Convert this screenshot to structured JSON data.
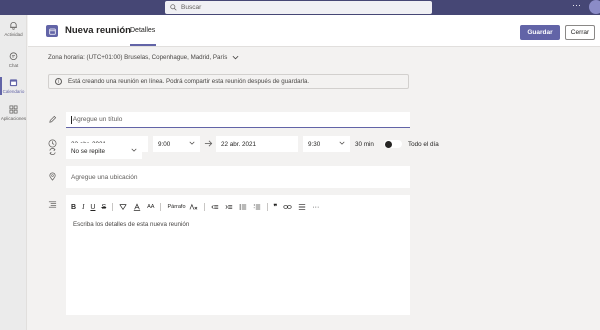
{
  "top_bar": {
    "search_placeholder": "Buscar",
    "more_label": "···"
  },
  "rail": {
    "items": [
      {
        "label": "Actividad",
        "icon": "bell-icon"
      },
      {
        "label": "Chat",
        "icon": "chat-icon"
      },
      {
        "label": "Calendario",
        "icon": "calendar-icon"
      },
      {
        "label": "Aplicaciones",
        "icon": "apps-icon"
      }
    ]
  },
  "header": {
    "title": "Nueva reunión",
    "tab": "Detalles",
    "save_label": "Guardar",
    "close_label": "Cerrar"
  },
  "timezone": "Zona horaria: (UTC+01:00) Bruselas, Copenhague, Madrid, París",
  "info_text": "Está creando una reunión en línea. Podrá compartir esta reunión después de guardarla.",
  "form": {
    "title_placeholder": "Agregue un título",
    "start_date": "22 abr. 2021",
    "start_time": "9:00",
    "end_date": "22 abr. 2021",
    "end_time": "9:30",
    "duration": "30 min",
    "all_day_label": "Todo el día",
    "repeat": "No se repite",
    "location_placeholder": "Agregue una ubicación",
    "details_placeholder": "Escriba los detalles de esta nueva reunión"
  },
  "toolbar": {
    "bold": "B",
    "italic": "I",
    "underline": "U",
    "strike": "S",
    "paragraph": "Párrafo",
    "font_size": "AA",
    "quote": "❞",
    "more": "···"
  },
  "colors": {
    "accent": "#6264a7",
    "topbar": "#464775"
  }
}
